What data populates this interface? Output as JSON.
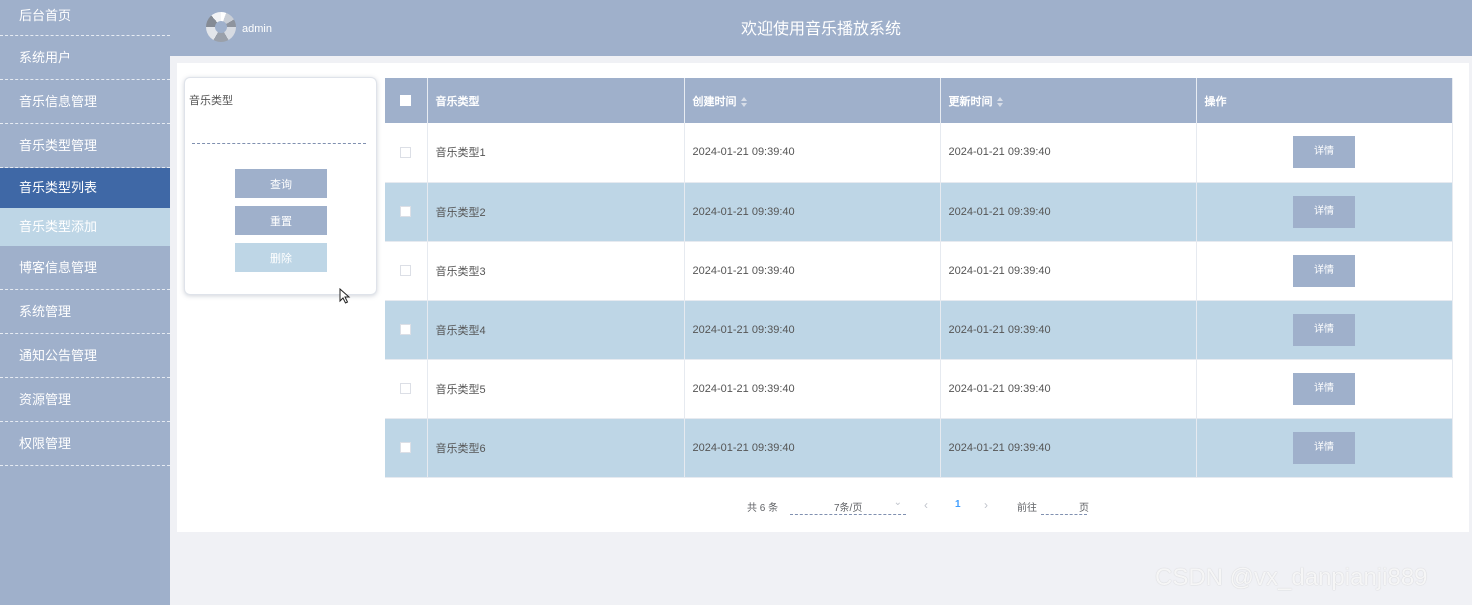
{
  "sidebar": {
    "items": [
      {
        "label": "后台首页"
      },
      {
        "label": "系统用户"
      },
      {
        "label": "音乐信息管理"
      },
      {
        "label": "音乐类型管理"
      },
      {
        "label": "音乐类型列表"
      },
      {
        "label": "音乐类型添加"
      },
      {
        "label": "博客信息管理"
      },
      {
        "label": "系统管理"
      },
      {
        "label": "通知公告管理"
      },
      {
        "label": "资源管理"
      },
      {
        "label": "权限管理"
      }
    ]
  },
  "header": {
    "user": "admin",
    "title": "欢迎使用音乐播放系统"
  },
  "search": {
    "label": "音乐类型",
    "value": "",
    "query_label": "查询",
    "reset_label": "重置",
    "delete_label": "删除"
  },
  "table": {
    "headers": [
      "音乐类型",
      "创建时间",
      "更新时间",
      "操作"
    ],
    "detail_label": "详情",
    "rows": [
      {
        "type": "音乐类型1",
        "created": "2024-01-21 09:39:40",
        "updated": "2024-01-21 09:39:40"
      },
      {
        "type": "音乐类型2",
        "created": "2024-01-21 09:39:40",
        "updated": "2024-01-21 09:39:40"
      },
      {
        "type": "音乐类型3",
        "created": "2024-01-21 09:39:40",
        "updated": "2024-01-21 09:39:40"
      },
      {
        "type": "音乐类型4",
        "created": "2024-01-21 09:39:40",
        "updated": "2024-01-21 09:39:40"
      },
      {
        "type": "音乐类型5",
        "created": "2024-01-21 09:39:40",
        "updated": "2024-01-21 09:39:40"
      },
      {
        "type": "音乐类型6",
        "created": "2024-01-21 09:39:40",
        "updated": "2024-01-21 09:39:40"
      }
    ]
  },
  "pagination": {
    "total": "共 6 条",
    "page_size": "7条/页",
    "current": "1",
    "goto": "前往",
    "unit": "页"
  },
  "watermark": "CSDN @vx_danpianji889",
  "colors": {
    "primary": "#9fb0cb",
    "active": "#3f68a6",
    "stripe": "#bed6e6",
    "link": "#409eff"
  }
}
